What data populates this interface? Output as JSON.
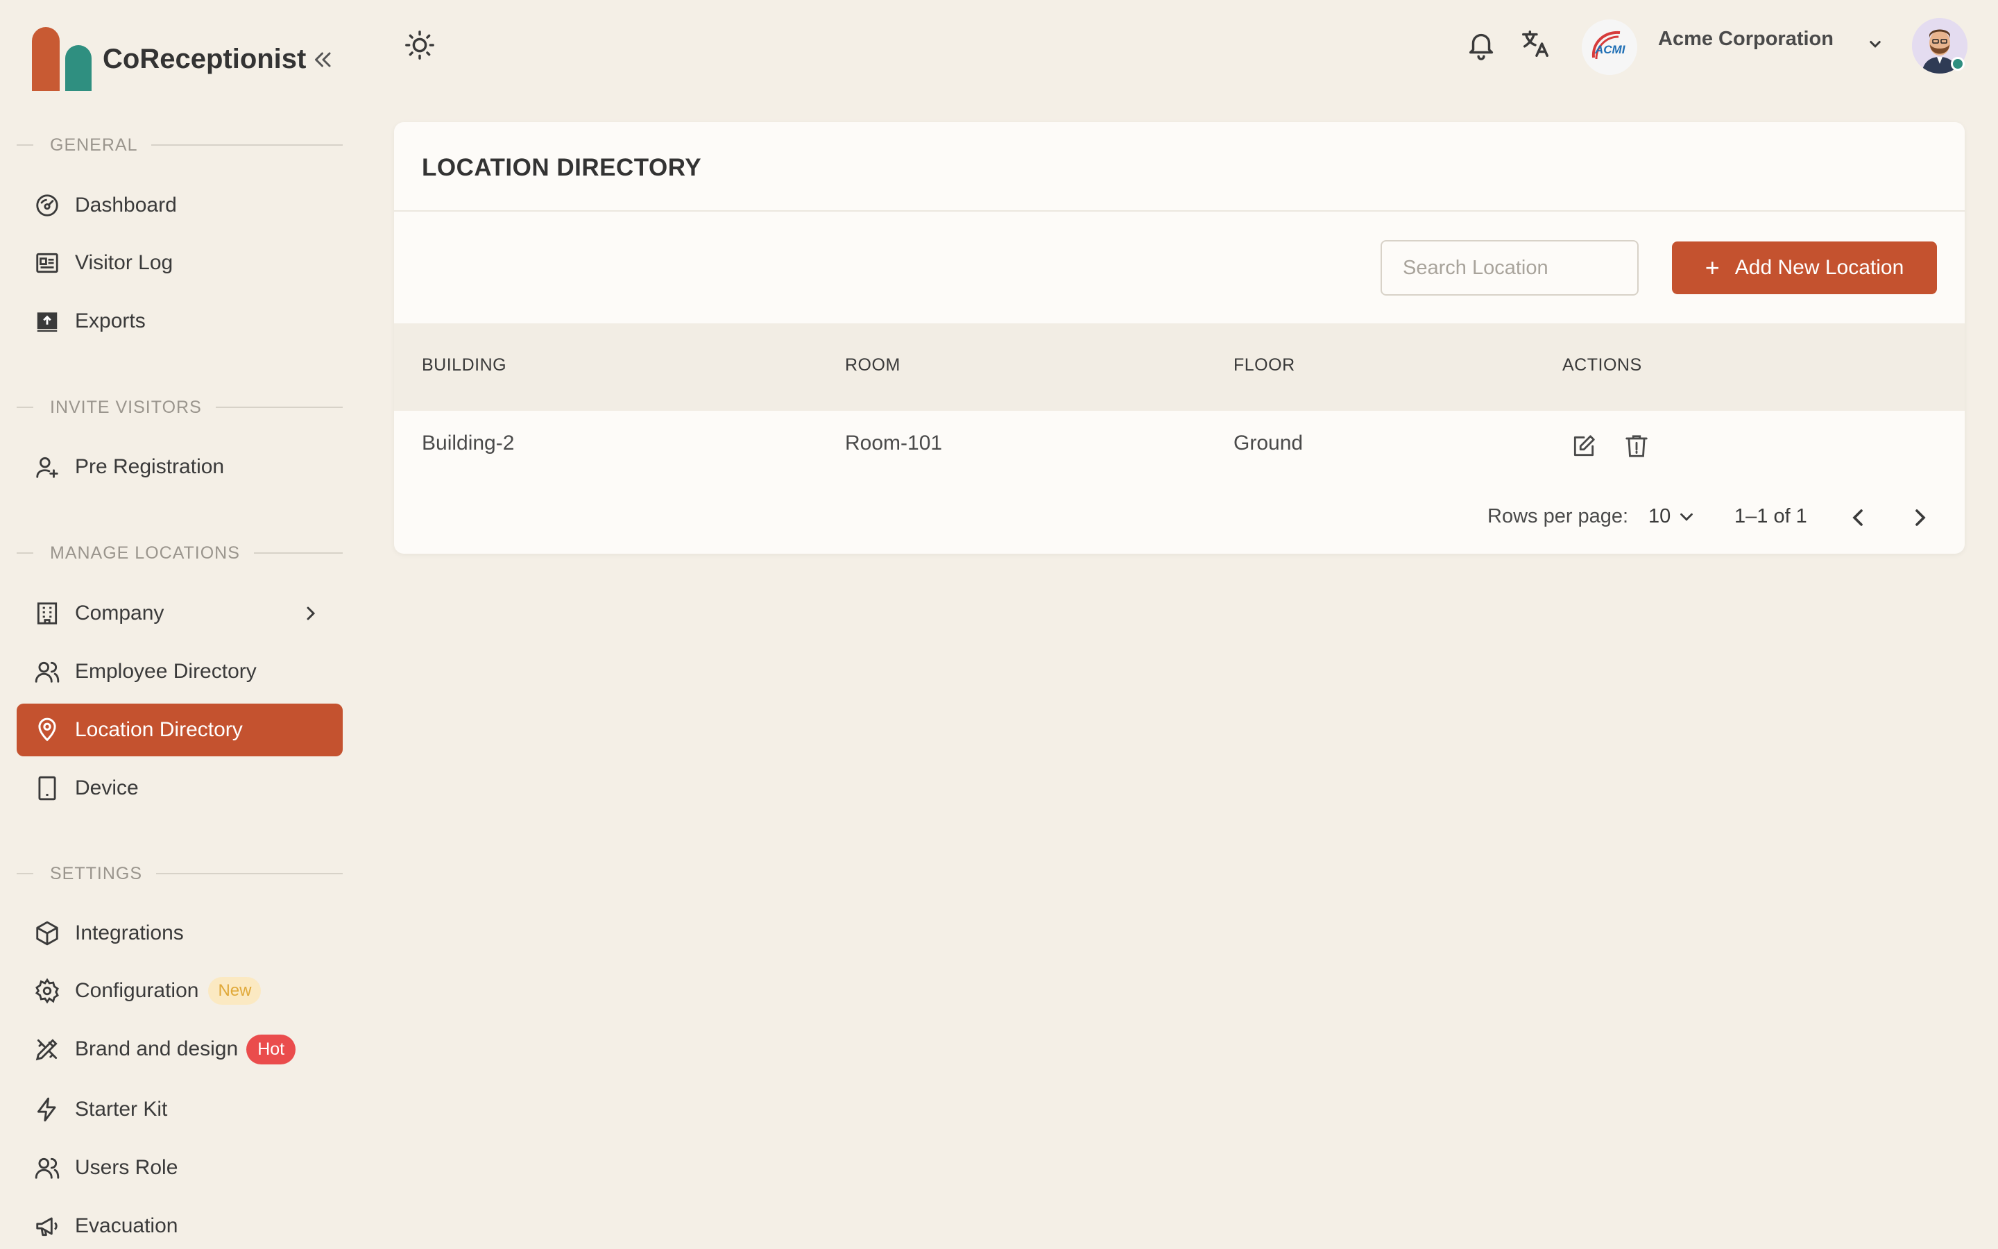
{
  "app": {
    "name": "CoReceptionist",
    "colors": {
      "accent": "#c4522f",
      "teal": "#2f8f80",
      "background": "#f4efe6"
    }
  },
  "sidebar": {
    "sections": [
      {
        "label": "GENERAL"
      },
      {
        "label": "INVITE VISITORS"
      },
      {
        "label": "MANAGE LOCATIONS"
      },
      {
        "label": "SETTINGS"
      }
    ],
    "items": [
      {
        "label": "Dashboard",
        "icon": "dashboard-gauge-icon"
      },
      {
        "label": "Visitor Log",
        "icon": "visitor-log-icon"
      },
      {
        "label": "Exports",
        "icon": "export-icon"
      },
      {
        "label": "Pre Registration",
        "icon": "user-plus-icon"
      },
      {
        "label": "Company",
        "icon": "building-icon"
      },
      {
        "label": "Employee Directory",
        "icon": "users-icon"
      },
      {
        "label": "Location Directory",
        "icon": "map-pin-icon",
        "active": true
      },
      {
        "label": "Device",
        "icon": "tablet-icon"
      },
      {
        "label": "Integrations",
        "icon": "cube-icon"
      },
      {
        "label": "Configuration",
        "icon": "gear-icon",
        "badge": "New"
      },
      {
        "label": "Brand and design",
        "icon": "design-tools-icon",
        "badge": "Hot"
      },
      {
        "label": "Starter Kit",
        "icon": "lightning-icon"
      },
      {
        "label": "Users Role",
        "icon": "users-role-icon"
      },
      {
        "label": "Evacuation",
        "icon": "megaphone-icon"
      }
    ]
  },
  "header": {
    "company": "Acme Corporation",
    "company_logo_text": "ACMI",
    "icons": [
      "sun-icon",
      "bell-icon",
      "translate-icon",
      "chevron-down-icon",
      "avatar"
    ]
  },
  "page": {
    "title": "LOCATION DIRECTORY",
    "search": {
      "placeholder": "Search Location",
      "value": ""
    },
    "add_button": "Add New Location",
    "table": {
      "columns": [
        "BUILDING",
        "ROOM",
        "FLOOR",
        "ACTIONS"
      ],
      "rows": [
        {
          "building": "Building-2",
          "room": "Room-101",
          "floor": "Ground"
        }
      ]
    },
    "pagination": {
      "rows_per_page_label": "Rows per page:",
      "rows_per_page": "10",
      "range": "1–1 of 1"
    }
  }
}
